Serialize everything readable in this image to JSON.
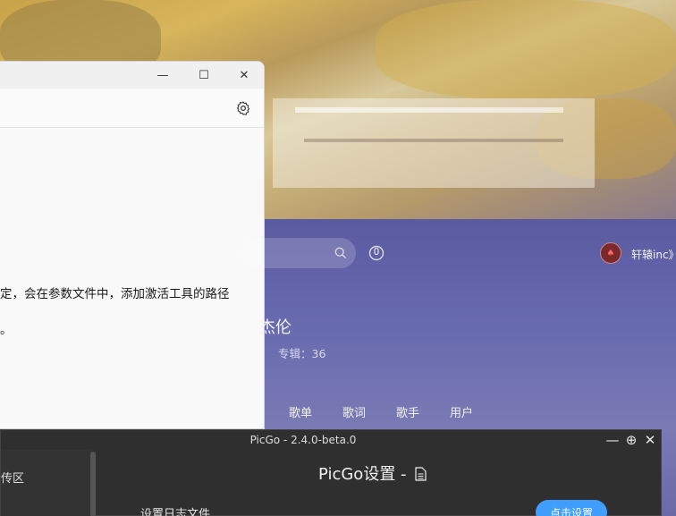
{
  "notepad": {
    "line1": "定，会在参数文件中，添加激活工具的路径",
    "line2": "。",
    "min_icon": "—",
    "max_icon": "☐",
    "close_icon": "✕"
  },
  "music": {
    "username": "轩辕inc》",
    "artist_fragment": "杰伦",
    "albums_label": "专辑：36",
    "categories": [
      "歌单",
      "歌词",
      "歌手",
      "用户"
    ]
  },
  "picgo": {
    "title": "PicGo - 2.4.0-beta.0",
    "sidebar_upload": "传区",
    "heading": "PicGo设置 -",
    "row_label": "设置日志文件",
    "row_button": "点击设置",
    "min_icon": "—",
    "add_icon": "⊕",
    "close_icon": "✕"
  },
  "colors": {
    "accent": "#409eff"
  }
}
